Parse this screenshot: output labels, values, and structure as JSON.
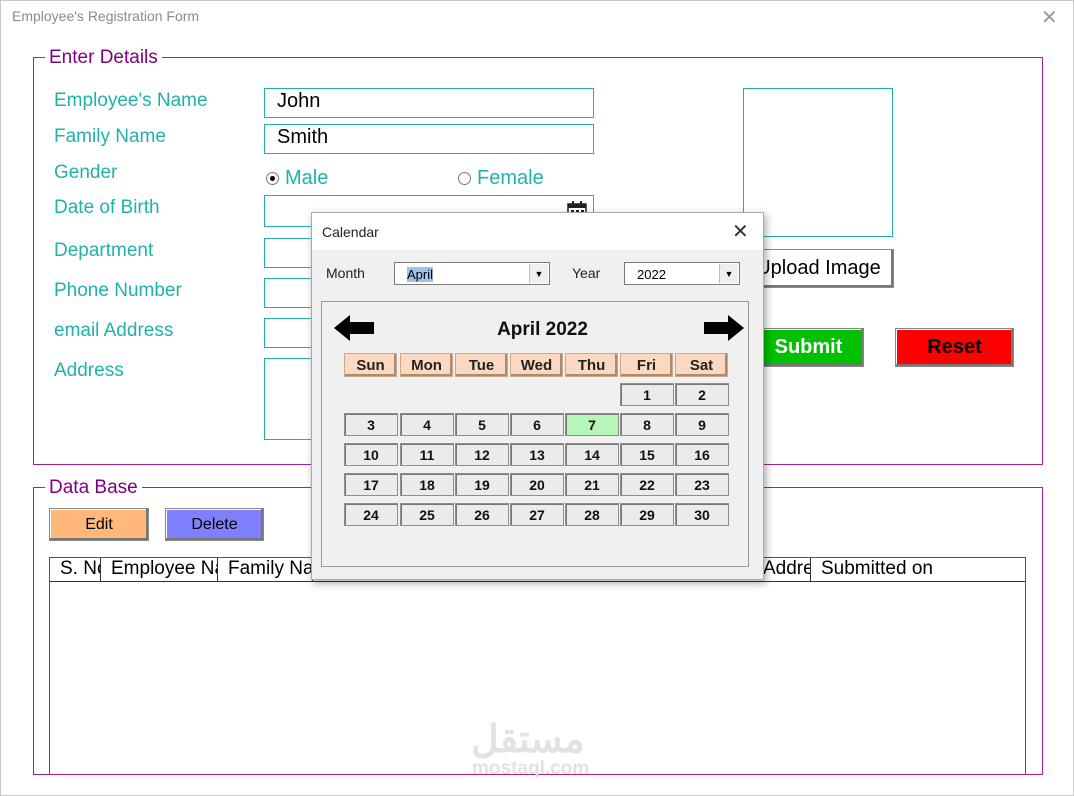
{
  "window": {
    "title": "Employee's Registration Form"
  },
  "details": {
    "legend": "Enter Details",
    "labels": {
      "name": "Employee's Name",
      "family": "Family Name",
      "gender": "Gender",
      "dob": "Date of Birth",
      "department": "Department",
      "phone": "Phone Number",
      "email": "email Address",
      "address": "Address"
    },
    "values": {
      "name": "John",
      "family": "Smith"
    },
    "gender_options": {
      "male": "Male",
      "female": "Female",
      "selected": "Male"
    },
    "upload_label": "Upload Image",
    "submit_label": "Submit",
    "reset_label": "Reset"
  },
  "database": {
    "legend": "Data Base",
    "edit_label": "Edit",
    "delete_label": "Delete",
    "columns": [
      "S. No",
      "Employee Name",
      "Family Name",
      "Addre",
      "Submitted on"
    ]
  },
  "calendar": {
    "title": "Calendar",
    "month_label": "Month",
    "year_label": "Year",
    "month_value": "April",
    "year_value": "2022",
    "heading": "April 2022",
    "weekdays": [
      "Sun",
      "Mon",
      "Tue",
      "Wed",
      "Thu",
      "Fri",
      "Sat"
    ],
    "first_weekday_index": 5,
    "days_in_month": 30,
    "today": 7
  },
  "watermark": {
    "arabic": "مستقل",
    "latin": "mostaql.com"
  },
  "colors": {
    "teal": "#20b2aa",
    "purple": "#800080",
    "edit": "#ffb87a",
    "delete": "#8080ff",
    "submit": "#00c000",
    "reset": "#ff0000",
    "today": "#b8f5b8",
    "weekday_header": "#fbd9c0"
  },
  "icons": {
    "prev": "arrow-left-icon",
    "next": "arrow-right-icon",
    "date": "calendar-icon"
  }
}
